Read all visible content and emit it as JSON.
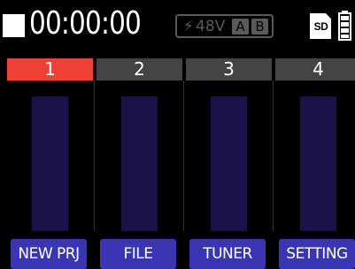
{
  "status": {
    "timecode": "00:00:00",
    "phantom_power": "48V",
    "phantom_channels": [
      "A",
      "B"
    ],
    "storage": "SD",
    "icons": {
      "record_state": "stop-icon",
      "phantom": "bolt-icon",
      "battery": "battery-icon"
    }
  },
  "tracks": [
    {
      "label": "1",
      "armed": true,
      "level": 0
    },
    {
      "label": "2",
      "armed": false,
      "level": 0
    },
    {
      "label": "3",
      "armed": false,
      "level": 0
    },
    {
      "label": "4",
      "armed": false,
      "level": 0
    }
  ],
  "function_buttons": [
    "NEW PRJ",
    "FILE",
    "TUNER",
    "SETTING"
  ],
  "colors": {
    "armed_track": "#ee4034",
    "idle_track": "#444444",
    "meter": "#1b124a",
    "button": "#3a36b3",
    "disabled": "#5a5a5a"
  }
}
